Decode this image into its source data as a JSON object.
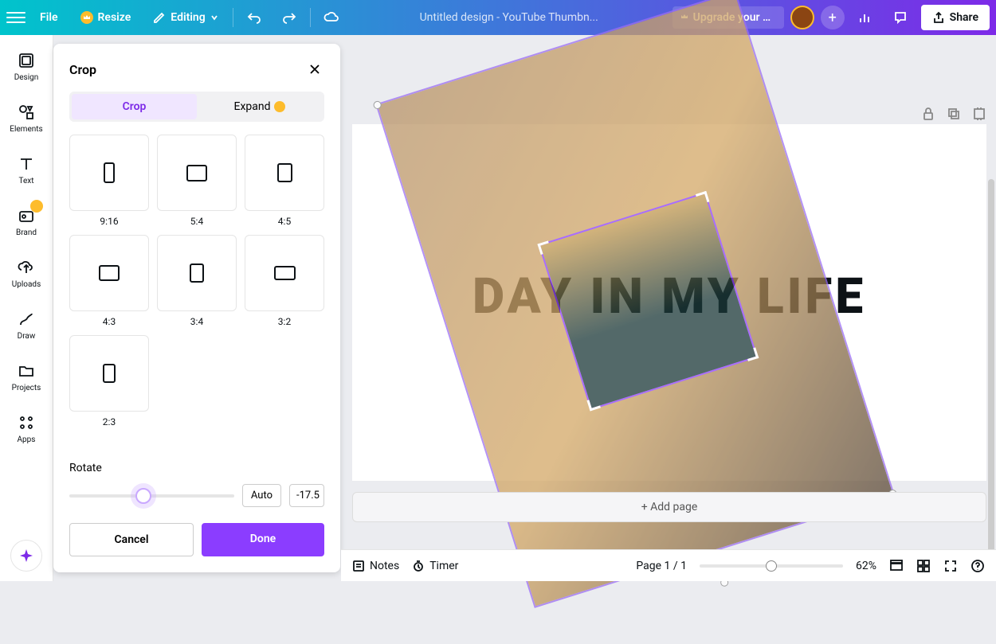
{
  "topbar": {
    "file_label": "File",
    "resize_label": "Resize",
    "editing_label": "Editing",
    "doc_title": "Untitled design - YouTube Thumbn...",
    "upgrade_label": "Upgrade your pl...",
    "share_label": "Share"
  },
  "sidebar": {
    "items": [
      {
        "label": "Design"
      },
      {
        "label": "Elements"
      },
      {
        "label": "Text"
      },
      {
        "label": "Brand"
      },
      {
        "label": "Uploads"
      },
      {
        "label": "Draw"
      },
      {
        "label": "Projects"
      },
      {
        "label": "Apps"
      }
    ]
  },
  "crop_panel": {
    "title": "Crop",
    "tabs": {
      "crop": "Crop",
      "expand": "Expand"
    },
    "ratios": [
      "9:16",
      "5:4",
      "4:5",
      "4:3",
      "3:4",
      "3:2",
      "2:3"
    ],
    "rotate_label": "Rotate",
    "rotate_auto": "Auto",
    "rotate_value": "-17.5",
    "cancel": "Cancel",
    "done": "Done"
  },
  "canvas": {
    "text": "DAY IN MY LIFE",
    "add_page": "+ Add page"
  },
  "bottom": {
    "notes": "Notes",
    "timer": "Timer",
    "page_indicator": "Page 1 / 1",
    "zoom": "62%"
  }
}
